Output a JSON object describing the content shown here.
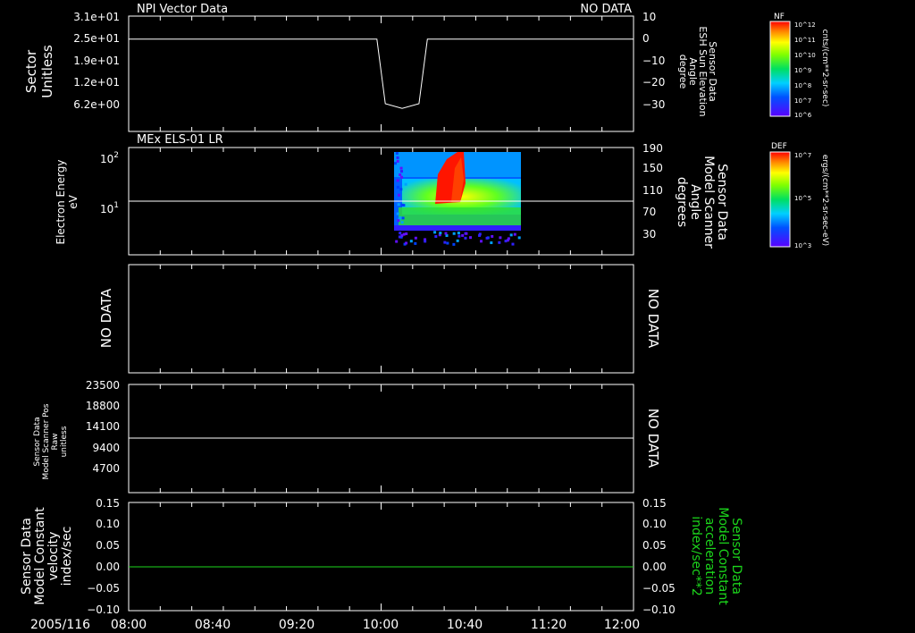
{
  "date_label": "2005/116",
  "colors": {
    "background": "#000000",
    "foreground": "#ffffff",
    "green": "#1cd61c"
  },
  "colorbars": [
    {
      "label": "NF",
      "units": "cnts/(cm**2-sr-sec)",
      "ticks": [
        "10^12",
        "10^11",
        "10^10",
        "10^9",
        "10^8",
        "10^7",
        "10^6"
      ]
    },
    {
      "label": "DEF",
      "units": "ergs/(cm**2-sr-sec-eV)",
      "ticks": [
        "10^7",
        "10^5",
        "10^3"
      ]
    }
  ],
  "panels": [
    {
      "title": "NPI Vector Data",
      "right_title": "NO DATA",
      "left_label": [
        "Sector",
        "Unitless"
      ],
      "left_ticks": [
        "3.1e+01",
        "2.5e+01",
        "1.9e+01",
        "1.2e+01",
        "6.2e+00"
      ],
      "right_label": [
        "Sensor Data",
        "ESH Sun Elevation",
        "Angle",
        "degree"
      ],
      "right_ticks": [
        "10",
        "0",
        "−10",
        "−20",
        "−30"
      ]
    },
    {
      "title": "MEx ELS-01 LR",
      "left_label": [
        "Electron Energy",
        "eV"
      ],
      "left_ticks": [
        "10^2",
        "10^1"
      ],
      "right_label": [
        "Sensor Data",
        "Model Scanner",
        "Angle",
        "degrees"
      ],
      "right_ticks": [
        "190",
        "150",
        "110",
        "70",
        "30"
      ]
    },
    {
      "left_label": [
        "NO DATA"
      ],
      "right_label": [
        "NO DATA"
      ]
    },
    {
      "left_label": [
        "Sensor Data",
        "Model Scanner Pos",
        "Raw",
        "unitless"
      ],
      "left_ticks": [
        "23500",
        "18800",
        "14100",
        "9400",
        "4700"
      ],
      "right_label": [
        "NO DATA"
      ]
    },
    {
      "left_label": [
        "Sensor Data",
        "Model Constant",
        "velocity",
        "index/sec"
      ],
      "left_ticks": [
        "0.15",
        "0.10",
        "0.05",
        "0.00",
        "−0.05",
        "−0.10"
      ],
      "right_label": [
        "Sensor Data",
        "Model Constant",
        "acceleration",
        "index/sec**2"
      ],
      "right_ticks": [
        "0.15",
        "0.10",
        "0.05",
        "0.00",
        "−0.05",
        "−0.10"
      ]
    }
  ],
  "chart_data": [
    {
      "type": "line",
      "title": "NPI Vector Data",
      "xlabel": "",
      "ylabel": "Sun Elevation Angle (degree)",
      "x": [
        "08:00",
        "09:00",
        "09:58",
        "10:02",
        "10:10",
        "10:18",
        "10:22",
        "12:00"
      ],
      "series": [
        {
          "name": "ESH Sun Elevation Angle",
          "values": [
            0,
            0,
            0,
            -28,
            -30,
            -28,
            0,
            0
          ]
        }
      ],
      "ylim": [
        -40,
        10
      ]
    },
    {
      "type": "heatmap",
      "title": "MEx ELS-01 LR",
      "ylabel": "Electron Energy (eV)",
      "y_scale": "log",
      "time_coverage": [
        "10:05",
        "11:03"
      ],
      "features": [
        {
          "region": "high flux (red)",
          "time": [
            "10:15",
            "10:36"
          ],
          "energy_eV": [
            20,
            150
          ]
        },
        {
          "region": "moderate flux (yellow/green)",
          "time": [
            "10:05",
            "11:03"
          ],
          "energy_eV": [
            5,
            30
          ]
        }
      ],
      "overlay": {
        "name": "Model Scanner Angle",
        "value_deg": 90,
        "ylim": [
          0,
          190
        ]
      }
    },
    {
      "type": "line",
      "ylabel": "Model Scanner Pos Raw (unitless)",
      "x": [
        "08:00",
        "12:00"
      ],
      "series": [
        {
          "name": "Scanner Pos",
          "values": [
            11300,
            11300
          ]
        }
      ],
      "ylim": [
        0,
        23500
      ]
    },
    {
      "type": "line",
      "ylabel": "Model Constant velocity (index/sec)",
      "x": [
        "08:00",
        "12:00"
      ],
      "series": [
        {
          "name": "acceleration",
          "values": [
            0.0,
            0.0
          ]
        }
      ],
      "ylim": [
        -0.1,
        0.15
      ]
    }
  ],
  "x_axis": {
    "ticks": [
      "08:00",
      "08:40",
      "09:20",
      "10:00",
      "10:40",
      "11:20",
      "12:00"
    ]
  }
}
